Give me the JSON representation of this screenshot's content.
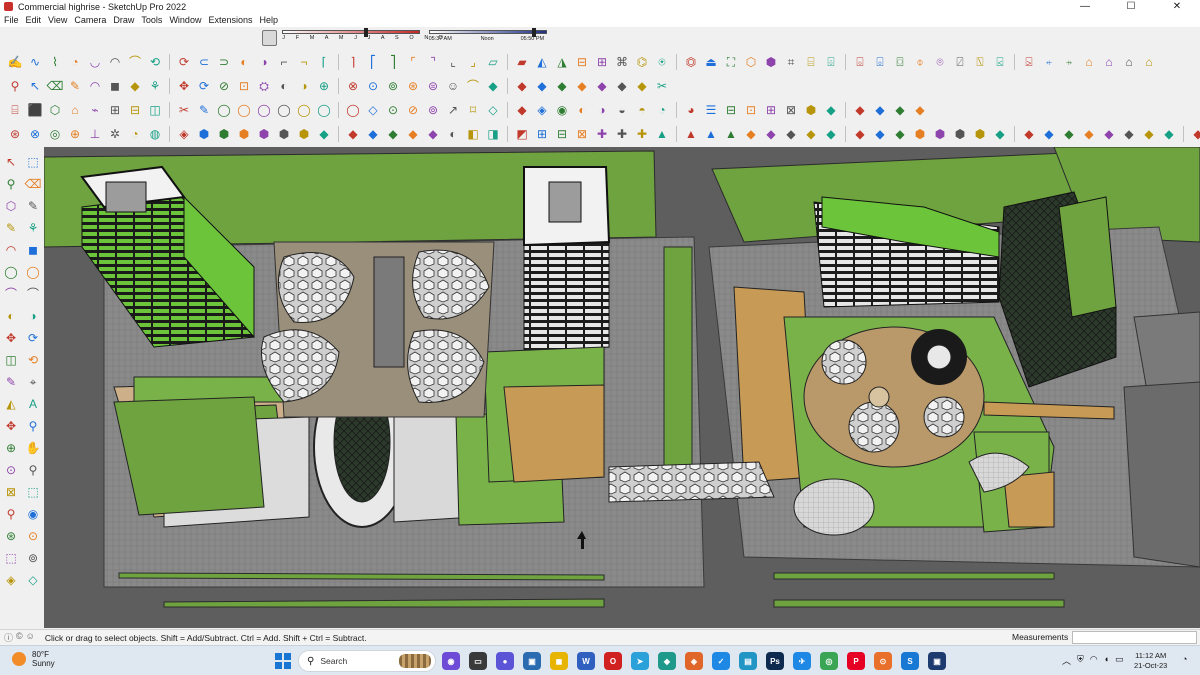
{
  "window": {
    "title": "Commercial highrise - SketchUp Pro 2022",
    "minimize": "—",
    "maximize": "☐",
    "close": "✕"
  },
  "menu": [
    "File",
    "Edit",
    "View",
    "Camera",
    "Draw",
    "Tools",
    "Window",
    "Extensions",
    "Help"
  ],
  "shadows": {
    "months": "J F M A M J J A S O N D",
    "sunrise": "05:37 AM",
    "noon": "Noon",
    "sunset": "05:50 PM",
    "month_position": 0.61,
    "time_position": 0.91
  },
  "toolbars": {
    "row1": [
      "✍",
      "∿",
      "⌇",
      "◔",
      "◡",
      "◠",
      "⌒",
      "⟲",
      "⟳",
      "⊂",
      "⊃",
      "◐",
      "◑",
      "⌐",
      "¬",
      "⌈",
      "⌉",
      "⎡",
      "⎤",
      "⌜",
      "⌝",
      "⌞",
      "⌟",
      "▱",
      "▰",
      "◭",
      "◮",
      "⊟",
      "⊞",
      "⌘",
      "⌬",
      "⍟",
      "⏣",
      "⏏",
      "⛶",
      "⬡",
      "⬢",
      "⌗",
      "⌸",
      "⌹",
      "⌺",
      "⌻",
      "⌼",
      "⌽",
      "⌾",
      "⍁",
      "⍂",
      "⍃",
      "⍄",
      "⍅",
      "⍆",
      "⌂",
      "⌂",
      "⌂",
      "⌂"
    ],
    "row2": [
      "⚲",
      "↖",
      "⌫",
      "✎",
      "◠",
      "◼",
      "◆",
      "⚘",
      "✥",
      "⟳",
      "⊘",
      "⊡",
      "⛭",
      "◐",
      "◑",
      "⊕",
      "⊗",
      "⊙",
      "⊚",
      "⊛",
      "⊜",
      "☺",
      "⌒",
      "◆",
      "◆",
      "◆",
      "◆",
      "◆",
      "◆",
      "◆",
      "◆",
      "✂"
    ],
    "row3": [
      "⌸",
      "⬛",
      "⬡",
      "⌂",
      "⌁",
      "⊞",
      "⊟",
      "◫",
      "✂",
      "✎",
      "◯",
      "◯",
      "◯",
      "◯",
      "◯",
      "◯",
      "◯",
      "◇",
      "⊙",
      "⊘",
      "⊚",
      "↗",
      "⌑",
      "◇",
      "◆",
      "◈",
      "◉",
      "◐",
      "◑",
      "◒",
      "◓",
      "◔",
      "◕",
      "☰",
      "⊟",
      "⊡",
      "⊞",
      "⊠",
      "⬢",
      "◆",
      "◆",
      "◆",
      "◆",
      "◆"
    ],
    "row4": [
      "⊛",
      "⊗",
      "◎",
      "⊕",
      "⊥",
      "✲",
      "◔",
      "◍",
      "◈",
      "⬢",
      "⬢",
      "⬢",
      "⬢",
      "⬢",
      "⬢",
      "◆",
      "◆",
      "◆",
      "◆",
      "◆",
      "◆",
      "◐",
      "◧",
      "◨",
      "◩",
      "⊞",
      "⊟",
      "⊠",
      "✚",
      "✚",
      "✚",
      "▲",
      "▲",
      "▲",
      "▲",
      "◆",
      "◆",
      "◆",
      "◆",
      "◆",
      "◆",
      "◆",
      "◆",
      "⬢",
      "⬢",
      "⬢",
      "⬢",
      "◆",
      "◆",
      "◆",
      "◆",
      "◆",
      "◆",
      "◆",
      "◆",
      "◆",
      "◆",
      "◆",
      "◆"
    ],
    "left": [
      "↖",
      "⬚",
      "⚲",
      "⌫",
      "⬡",
      "✎",
      "✎",
      "⚘",
      "◠",
      "◼",
      "◯",
      "◯",
      "⌒",
      "⌒",
      "◐",
      "◑",
      "✥",
      "⟳",
      "◫",
      "⟲",
      "✎",
      "⌖",
      "◭",
      "A",
      "✥",
      "⚲",
      "⊕",
      "✋",
      "⊙",
      "⚲",
      "⊠",
      "⬚",
      "⚲",
      "◉",
      "⊛",
      "⊙",
      "⬚",
      "⊚",
      "◈",
      "◇"
    ]
  },
  "status": {
    "hint": "Click or drag to select objects. Shift = Add/Subtract. Ctrl = Add. Shift + Ctrl = Subtract.",
    "measurements_label": "Measurements",
    "measurements_value": ""
  },
  "taskbar": {
    "temp": "80°F",
    "condition": "Sunny",
    "search": "Search",
    "time": "11:12 AM",
    "date": "21-Oct-23",
    "apps": [
      {
        "icon": "app-icon",
        "glyph": "◉",
        "color": "#6d4bd6"
      },
      {
        "icon": "app-icon",
        "glyph": "▭",
        "color": "#3a3a3a"
      },
      {
        "icon": "app-icon",
        "glyph": "●",
        "color": "#5b54d6"
      },
      {
        "icon": "app-icon",
        "glyph": "▣",
        "color": "#2b6cb0"
      },
      {
        "icon": "app-icon",
        "glyph": "◼",
        "color": "#e7b400"
      },
      {
        "icon": "app-icon",
        "glyph": "W",
        "color": "#2f5fbf"
      },
      {
        "icon": "app-icon",
        "glyph": "O",
        "color": "#d02020"
      },
      {
        "icon": "app-icon",
        "glyph": "➤",
        "color": "#2aa1d8"
      },
      {
        "icon": "app-icon",
        "glyph": "◆",
        "color": "#1f9a8a"
      },
      {
        "icon": "app-icon",
        "glyph": "◈",
        "color": "#e0662a"
      },
      {
        "icon": "app-icon",
        "glyph": "✓",
        "color": "#1e88e5"
      },
      {
        "icon": "app-icon",
        "glyph": "▤",
        "color": "#2196c5"
      },
      {
        "icon": "app-icon",
        "glyph": "Ps",
        "color": "#0e2a4f"
      },
      {
        "icon": "app-icon",
        "glyph": "✈",
        "color": "#1e88e5"
      },
      {
        "icon": "app-icon",
        "glyph": "◎",
        "color": "#3aa655"
      },
      {
        "icon": "app-icon",
        "glyph": "P",
        "color": "#e60023"
      },
      {
        "icon": "app-icon",
        "glyph": "⊙",
        "color": "#e8702a"
      },
      {
        "icon": "app-icon",
        "glyph": "S",
        "color": "#1779d4"
      },
      {
        "icon": "app-icon",
        "glyph": "▣",
        "color": "#1d3b6e"
      }
    ]
  }
}
